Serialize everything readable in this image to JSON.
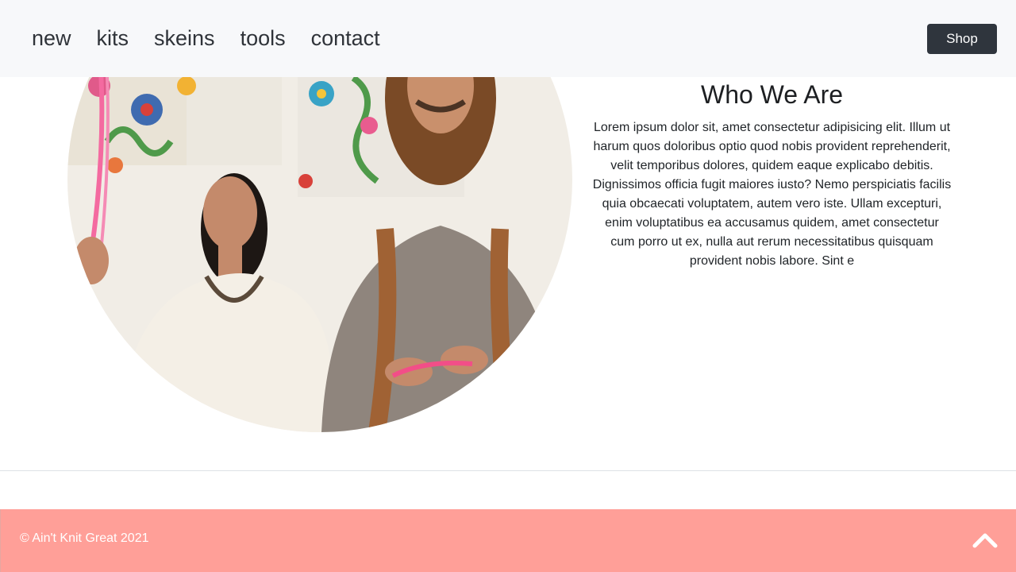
{
  "navbar": {
    "links": [
      "new",
      "kits",
      "skeins",
      "tools",
      "contact"
    ],
    "shop_label": "Shop"
  },
  "about": {
    "title": "Who We Are",
    "body": "Lorem ipsum dolor sit, amet consectetur adipisicing elit. Illum ut harum quos doloribus optio quod nobis provident reprehenderit, velit temporibus dolores, quidem eaque explicabo debitis. Dignissimos officia fugit maiores iusto? Nemo perspiciatis facilis quia obcaecati voluptatem, autem vero iste. Ullam excepturi, enim voluptatibus ea accusamus quidem, amet consectetur cum porro ut ex, nulla aut rerum necessitatibus quisquam provident nobis labore. Sint e"
  },
  "footer": {
    "copyright": "© Ain't Knit Great 2021",
    "back_to_top_icon": "chevron-up-icon"
  },
  "colors": {
    "navbar_bg": "#f7f8fa",
    "shop_button_bg": "#2f353d",
    "footer_bg": "#ff9f98"
  }
}
